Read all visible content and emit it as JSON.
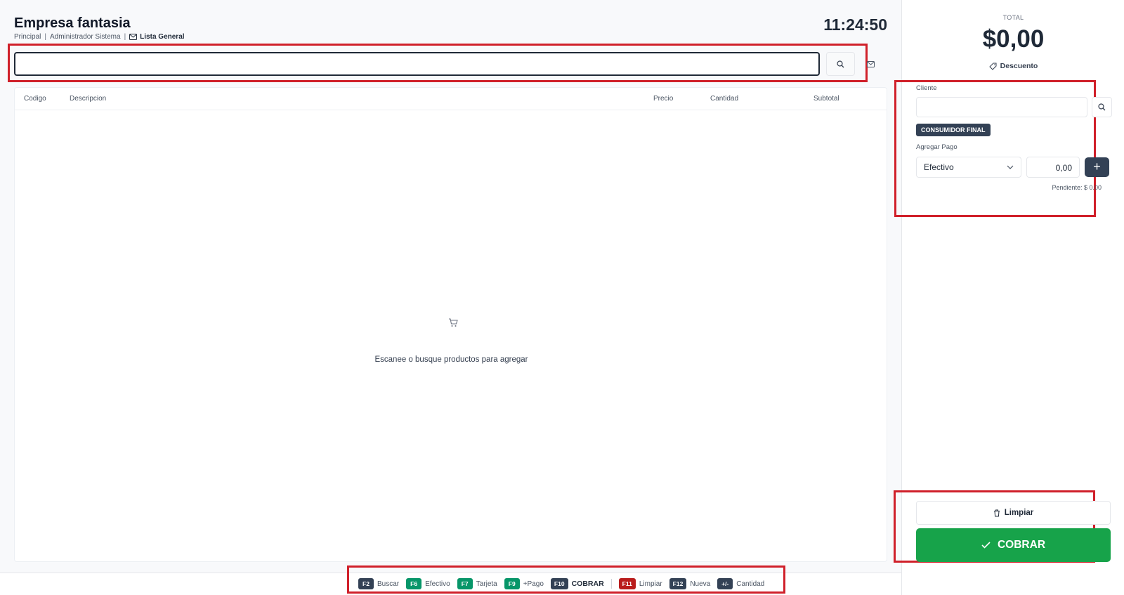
{
  "header": {
    "company": "Empresa fantasia",
    "branch": "Principal",
    "user": "Administrador Sistema",
    "price_list": "Lista General",
    "clock": "11:24:50"
  },
  "search": {
    "value": "",
    "placeholder": ""
  },
  "table": {
    "columns": [
      "Codigo",
      "Descripcion",
      "Precio",
      "Cantidad",
      "Subtotal"
    ],
    "rows": [],
    "empty_message": "Escanee o busque productos para agregar"
  },
  "shortcuts": [
    {
      "key": "F2",
      "label": "Buscar",
      "color": "#334155"
    },
    {
      "key": "F6",
      "label": "Efectivo",
      "color": "#079669"
    },
    {
      "key": "F7",
      "label": "Tarjeta",
      "color": "#079669"
    },
    {
      "key": "F9",
      "label": "+Pago",
      "color": "#079669"
    },
    {
      "key": "F10",
      "label": "COBRAR",
      "color": "#334155"
    },
    {
      "key": "F11",
      "label": "Limpiar",
      "color": "#b91c1c"
    },
    {
      "key": "F12",
      "label": "Nueva",
      "color": "#334155"
    },
    {
      "key": "+/-",
      "label": "Cantidad",
      "color": "#334155"
    }
  ],
  "summary": {
    "total_label": "TOTAL",
    "total_value": "$0,00",
    "discount_label": "Descuento"
  },
  "client": {
    "label": "Cliente",
    "value": "",
    "badge": "CONSUMIDOR FINAL"
  },
  "payment": {
    "label": "Agregar Pago",
    "method": "Efectivo",
    "amount": "0,00",
    "add_label": "+",
    "pending": "Pendiente: $ 0.00"
  },
  "actions": {
    "clear": "Limpiar",
    "charge": "COBRAR"
  },
  "colors": {
    "accent_dark": "#334155",
    "charge_green": "#17a34a",
    "highlight_red": "#d0202a"
  }
}
